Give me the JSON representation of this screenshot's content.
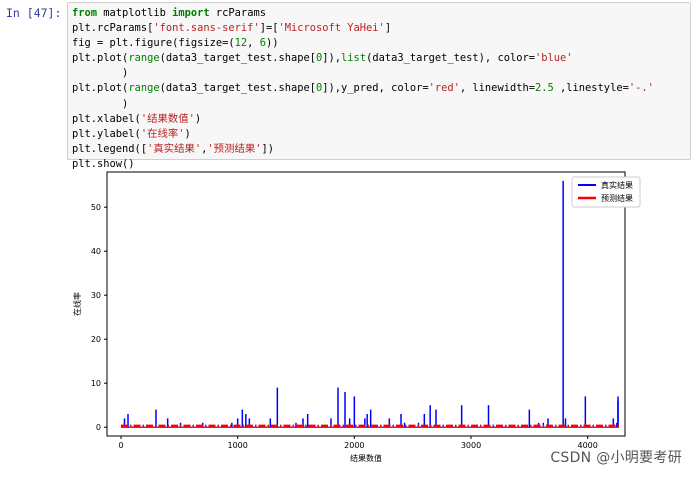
{
  "prompt_label": "In  [47]:",
  "code_lines": [
    [
      {
        "t": "from",
        "c": "kw"
      },
      {
        "t": " matplotlib "
      },
      {
        "t": "import",
        "c": "kw"
      },
      {
        "t": " rcParams"
      }
    ],
    [
      {
        "t": "plt.rcParams["
      },
      {
        "t": "'font.sans-serif'",
        "c": "st"
      },
      {
        "t": "]=["
      },
      {
        "t": "'Microsoft YaHei'",
        "c": "st"
      },
      {
        "t": "]"
      }
    ],
    [
      {
        "t": "fig = plt.figure(figsize=("
      },
      {
        "t": "12",
        "c": "num"
      },
      {
        "t": ", "
      },
      {
        "t": "6",
        "c": "num"
      },
      {
        "t": "))"
      }
    ],
    [
      {
        "t": "plt.plot("
      },
      {
        "t": "range",
        "c": "nm"
      },
      {
        "t": "(data3_target_test.shape["
      },
      {
        "t": "0",
        "c": "num"
      },
      {
        "t": "]),"
      },
      {
        "t": "list",
        "c": "nm"
      },
      {
        "t": "(data3_target_test), color="
      },
      {
        "t": "'blue'",
        "c": "st"
      }
    ],
    [
      {
        "t": "        )"
      }
    ],
    [
      {
        "t": "plt.plot("
      },
      {
        "t": "range",
        "c": "nm"
      },
      {
        "t": "(data3_target_test.shape["
      },
      {
        "t": "0",
        "c": "num"
      },
      {
        "t": "]),y_pred, color="
      },
      {
        "t": "'red'",
        "c": "st"
      },
      {
        "t": ", linewidth="
      },
      {
        "t": "2.5",
        "c": "num"
      },
      {
        "t": " ,linestyle="
      },
      {
        "t": "'-.'",
        "c": "st"
      }
    ],
    [
      {
        "t": "        )"
      }
    ],
    [
      {
        "t": "plt.xlabel("
      },
      {
        "t": "'结果数值'",
        "c": "st"
      },
      {
        "t": ")"
      }
    ],
    [
      {
        "t": "plt.ylabel("
      },
      {
        "t": "'在线率'",
        "c": "st"
      },
      {
        "t": ")"
      }
    ],
    [
      {
        "t": "plt.legend(["
      },
      {
        "t": "'真实结果'",
        "c": "st"
      },
      {
        "t": ","
      },
      {
        "t": "'预测结果'",
        "c": "st"
      },
      {
        "t": "])"
      }
    ],
    [
      {
        "t": "plt.show()"
      }
    ]
  ],
  "chart_data": {
    "type": "line",
    "xlabel": "结果数值",
    "ylabel": "在线率",
    "xlim": [
      -120,
      4320
    ],
    "ylim": [
      -2,
      58
    ],
    "xticks": [
      0,
      1000,
      2000,
      3000,
      4000
    ],
    "yticks": [
      0,
      10,
      20,
      30,
      40,
      50
    ],
    "legend_position": "top-right",
    "series": [
      {
        "name": "真实结果",
        "color": "#0000ff",
        "linewidth": 1.5,
        "linestyle": "solid",
        "baseline": 0,
        "spikes": [
          [
            30,
            2
          ],
          [
            60,
            3
          ],
          [
            300,
            4
          ],
          [
            400,
            2
          ],
          [
            510,
            1
          ],
          [
            700,
            1
          ],
          [
            950,
            1
          ],
          [
            1000,
            2
          ],
          [
            1040,
            4
          ],
          [
            1070,
            3
          ],
          [
            1100,
            2
          ],
          [
            1280,
            2
          ],
          [
            1340,
            9
          ],
          [
            1500,
            1
          ],
          [
            1560,
            2
          ],
          [
            1600,
            3
          ],
          [
            1800,
            2
          ],
          [
            1860,
            9
          ],
          [
            1920,
            8
          ],
          [
            1960,
            2
          ],
          [
            2000,
            7
          ],
          [
            2090,
            2
          ],
          [
            2110,
            3
          ],
          [
            2140,
            4
          ],
          [
            2300,
            2
          ],
          [
            2400,
            3
          ],
          [
            2430,
            1
          ],
          [
            2550,
            1
          ],
          [
            2600,
            3
          ],
          [
            2650,
            5
          ],
          [
            2700,
            4
          ],
          [
            2920,
            5
          ],
          [
            3150,
            5
          ],
          [
            3500,
            4
          ],
          [
            3580,
            1
          ],
          [
            3620,
            1
          ],
          [
            3660,
            2
          ],
          [
            3790,
            56
          ],
          [
            3810,
            2
          ],
          [
            3980,
            7
          ],
          [
            4220,
            2
          ],
          [
            4250,
            1
          ],
          [
            4280,
            7
          ],
          [
            4330,
            6
          ]
        ],
        "x_end": 4480
      },
      {
        "name": "预测结果",
        "color": "#ff0000",
        "linewidth": 2.5,
        "linestyle": "dashdot",
        "constant": 0.3,
        "x_end": 4480
      }
    ]
  },
  "watermark": "CSDN @小明要考研"
}
